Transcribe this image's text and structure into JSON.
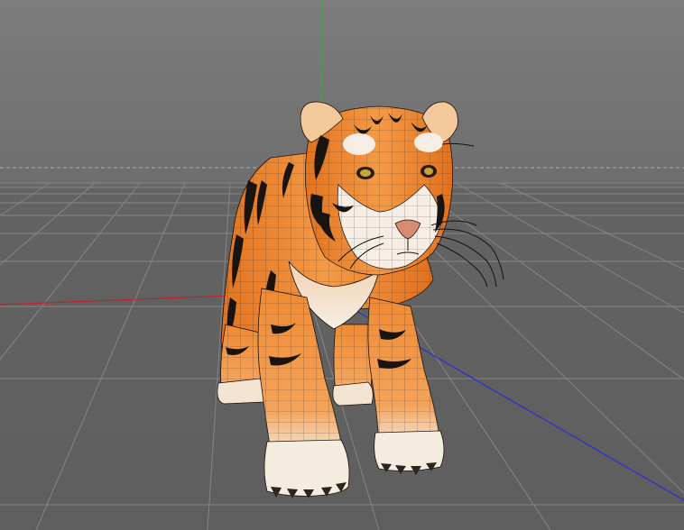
{
  "viewport": {
    "background_top": "#7c7c7c",
    "background_bottom": "#5e5e5e",
    "grid_color": "#858585",
    "horizon_line_color": "#aaaaaa",
    "axis_x_color": "#c8202a",
    "axis_y_color": "#2fae3b",
    "axis_z_color": "#2a2fd0"
  },
  "model": {
    "subject": "tiger",
    "display_mode": "shaded-with-wireframe",
    "fur_color": "#f0862c",
    "belly_color": "#f6eee4",
    "stripe_color": "#1a1410"
  }
}
